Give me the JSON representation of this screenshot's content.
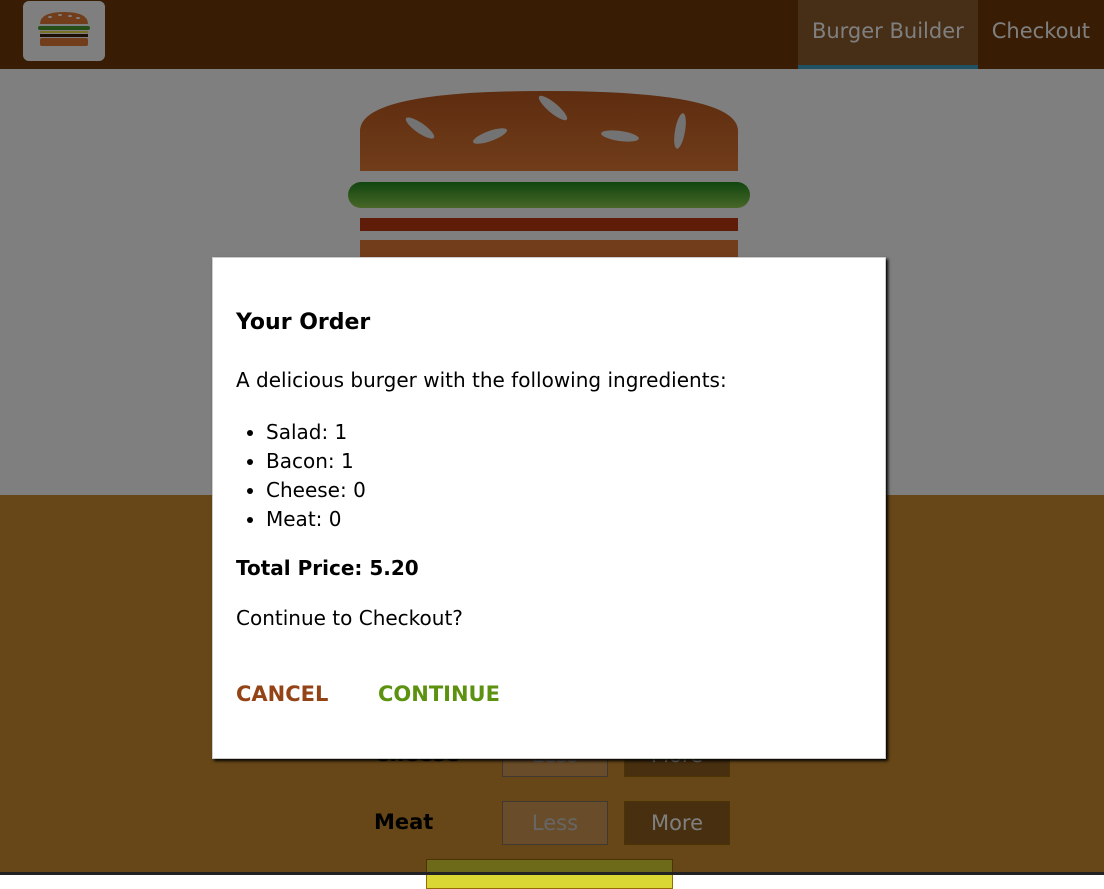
{
  "nav": {
    "items": [
      {
        "label": "Burger Builder",
        "active": true
      },
      {
        "label": "Checkout",
        "active": false
      }
    ]
  },
  "controls": [
    {
      "label": "Cheese",
      "less": "Less",
      "more": "More"
    },
    {
      "label": "Meat",
      "less": "Less",
      "more": "More"
    }
  ],
  "modal": {
    "title": "Your Order",
    "intro": "A delicious burger with the following ingredients:",
    "ingredients": [
      {
        "text": "Salad: 1"
      },
      {
        "text": "Bacon: 1"
      },
      {
        "text": "Cheese: 0"
      },
      {
        "text": "Meat: 0"
      }
    ],
    "total": "Total Price: 5.20",
    "question": "Continue to Checkout?",
    "cancel": "CANCEL",
    "continue": "CONTINUE"
  },
  "colors": {
    "toolbar": "#703b09",
    "active_nav_border": "#40a4c8",
    "controls_bg": "#cf8f2e",
    "cancel": "#944317",
    "continue": "#5c9210"
  },
  "icons": [
    "burger-logo-icon"
  ]
}
